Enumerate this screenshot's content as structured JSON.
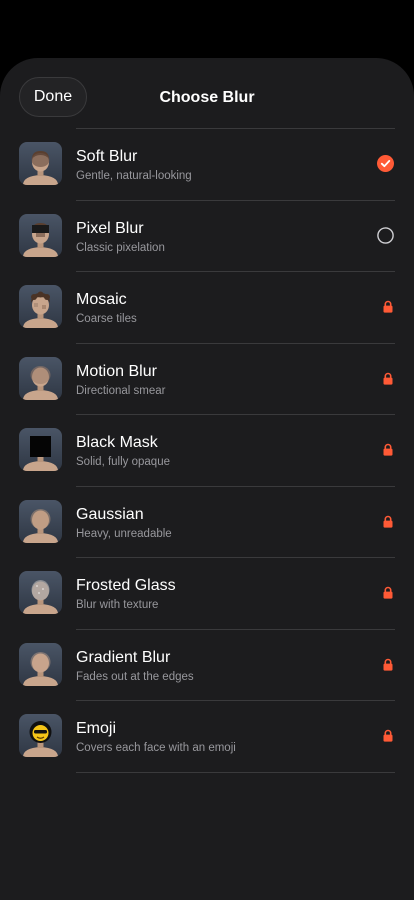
{
  "header": {
    "done_label": "Done",
    "title": "Choose Blur"
  },
  "accent_color": "#ff5a36",
  "items": [
    {
      "title": "Soft Blur",
      "subtitle": "Gentle, natural-looking",
      "state": "selected",
      "thumb": "soft-blur"
    },
    {
      "title": "Pixel Blur",
      "subtitle": "Classic pixelation",
      "state": "unselected",
      "thumb": "pixel-blur"
    },
    {
      "title": "Mosaic",
      "subtitle": "Coarse tiles",
      "state": "locked",
      "thumb": "mosaic"
    },
    {
      "title": "Motion Blur",
      "subtitle": "Directional smear",
      "state": "locked",
      "thumb": "motion-blur"
    },
    {
      "title": "Black Mask",
      "subtitle": "Solid, fully opaque",
      "state": "locked",
      "thumb": "black-mask"
    },
    {
      "title": "Gaussian",
      "subtitle": "Heavy, unreadable",
      "state": "locked",
      "thumb": "gaussian"
    },
    {
      "title": "Frosted Glass",
      "subtitle": "Blur with texture",
      "state": "locked",
      "thumb": "frosted-glass"
    },
    {
      "title": "Gradient Blur",
      "subtitle": "Fades out at the edges",
      "state": "locked",
      "thumb": "gradient-blur"
    },
    {
      "title": "Emoji",
      "subtitle": "Covers each face with an emoji",
      "state": "locked",
      "thumb": "emoji"
    }
  ]
}
